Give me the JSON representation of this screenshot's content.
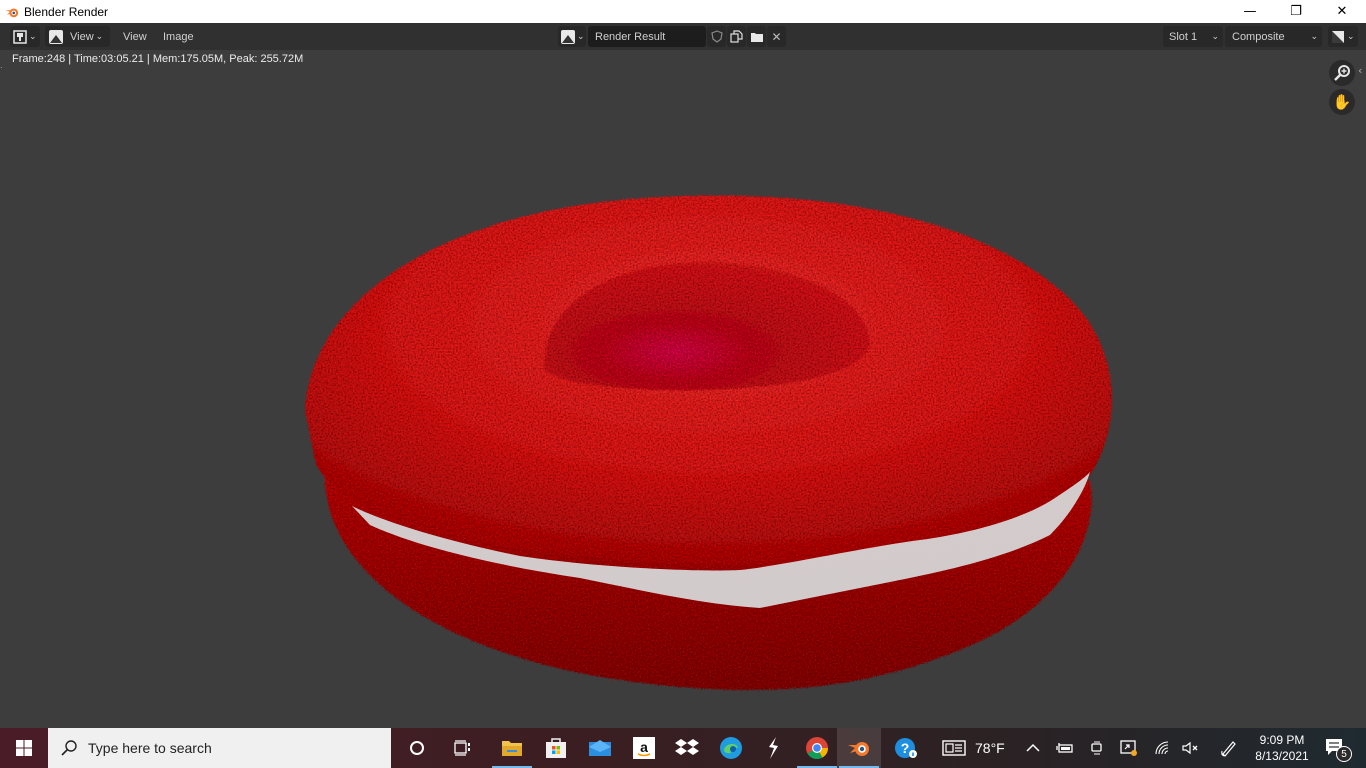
{
  "window": {
    "title": "Blender Render",
    "minimize_label": "—",
    "restore_label": "❐",
    "close_label": "✕"
  },
  "header": {
    "view_menu_label": "View",
    "menu_items": [
      "View",
      "Image"
    ],
    "image_name": "Render Result",
    "slot": "Slot 1",
    "layer": "Composite"
  },
  "status": {
    "text": "Frame:248 | Time:03:05.21 | Mem:175.05M, Peak: 255.72M"
  },
  "render": {
    "subject": "Fuzzy red torus-shaped object (red blood cell / macaron) with white filling band",
    "background_color": "#3d3d3d",
    "fur_color": "#e01515",
    "filling_color": "#d8d8d8"
  },
  "taskbar": {
    "search_placeholder": "Type here to search",
    "weather": "78°F",
    "time": "9:09 PM",
    "date": "8/13/2021",
    "notification_count": "5",
    "apps": [
      "task-view",
      "file-explorer",
      "microsoft-store",
      "mail",
      "amazon",
      "dropbox",
      "edge",
      "unknown-app",
      "chrome",
      "blender",
      "help"
    ]
  }
}
